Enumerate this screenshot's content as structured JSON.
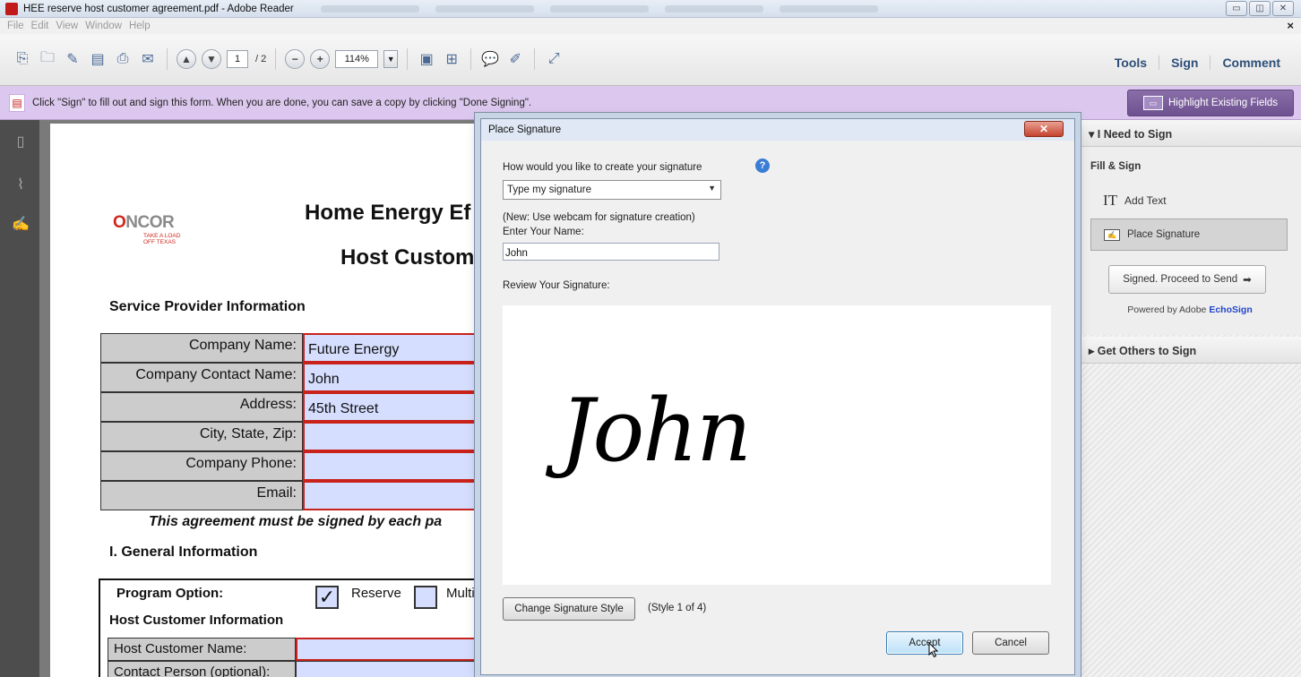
{
  "window": {
    "title": "HEE reserve host customer agreement.pdf - Adobe Reader",
    "controls": [
      "minimize",
      "maximize",
      "close"
    ]
  },
  "menu": {
    "items": [
      "File",
      "Edit",
      "View",
      "Window",
      "Help"
    ],
    "close_glyph": "×"
  },
  "toolbar": {
    "page_current": "1",
    "page_total": "/ 2",
    "zoom": "114%",
    "icons": [
      "create-pdf-icon",
      "open-icon",
      "edit-icon",
      "save-icon",
      "print-icon",
      "email-icon",
      "prev-page-icon",
      "next-page-icon",
      "zoom-out-icon",
      "zoom-in-icon",
      "fit-page-icon",
      "fit-width-icon",
      "comment-icon",
      "highlight-icon",
      "fullscreen-icon"
    ],
    "tabs": [
      "Tools",
      "Sign",
      "Comment"
    ]
  },
  "message_bar": {
    "text": "Click \"Sign\" to fill out and sign this form. When you are done, you can save a copy by clicking \"Done Signing\".",
    "highlight_button": "Highlight Existing Fields"
  },
  "document": {
    "logo": {
      "prefix": "O",
      "name": "NCOR",
      "tagline_1": "TAKE A LOAD",
      "tagline_2": "OFF TEXAS"
    },
    "title_line_1": "Home Energy Ef",
    "title_line_2": "Host Custom",
    "section_service": "Service Provider Information",
    "fields": [
      {
        "label": "Company Name:",
        "value": "Future Energy"
      },
      {
        "label": "Company Contact Name:",
        "value": "John"
      },
      {
        "label": "Address:",
        "value": "45th Street"
      },
      {
        "label": "City, State, Zip:",
        "value": ""
      },
      {
        "label": "Company Phone:",
        "value": ""
      },
      {
        "label": "Email:",
        "value": ""
      }
    ],
    "agreement_note": "This agreement must be signed by each pa",
    "section_general": "I. General Information",
    "program_option": "Program Option:",
    "option_reserve": "Reserve",
    "option_multi": "Multif",
    "reserve_checked": "✓",
    "host_info": "Host Customer Information",
    "host_fields": [
      {
        "label": "Host Customer Name:"
      },
      {
        "label": "Contact Person (optional):"
      }
    ]
  },
  "right_pane": {
    "section_need_to_sign": "I Need to Sign",
    "fill_sign": "Fill & Sign",
    "add_text": "Add Text",
    "place_signature": "Place Signature",
    "proceed": "Signed. Proceed to Send",
    "powered_prefix": "Powered by Adobe",
    "powered_brand": "EchoSign",
    "section_get_others": "Get Others to Sign"
  },
  "dialog": {
    "title": "Place Signature",
    "question": "How would you like to create your signature",
    "method_selected": "Type my signature",
    "webcam_note": "(New: Use webcam for signature creation)",
    "name_label": "Enter Your Name:",
    "name_value": "John",
    "review_label": "Review Your Signature:",
    "signature_preview": "John",
    "change_style_button": "Change Signature Style",
    "style_count": "(Style 1 of 4)",
    "accept_button": "Accept",
    "cancel_button": "Cancel"
  }
}
